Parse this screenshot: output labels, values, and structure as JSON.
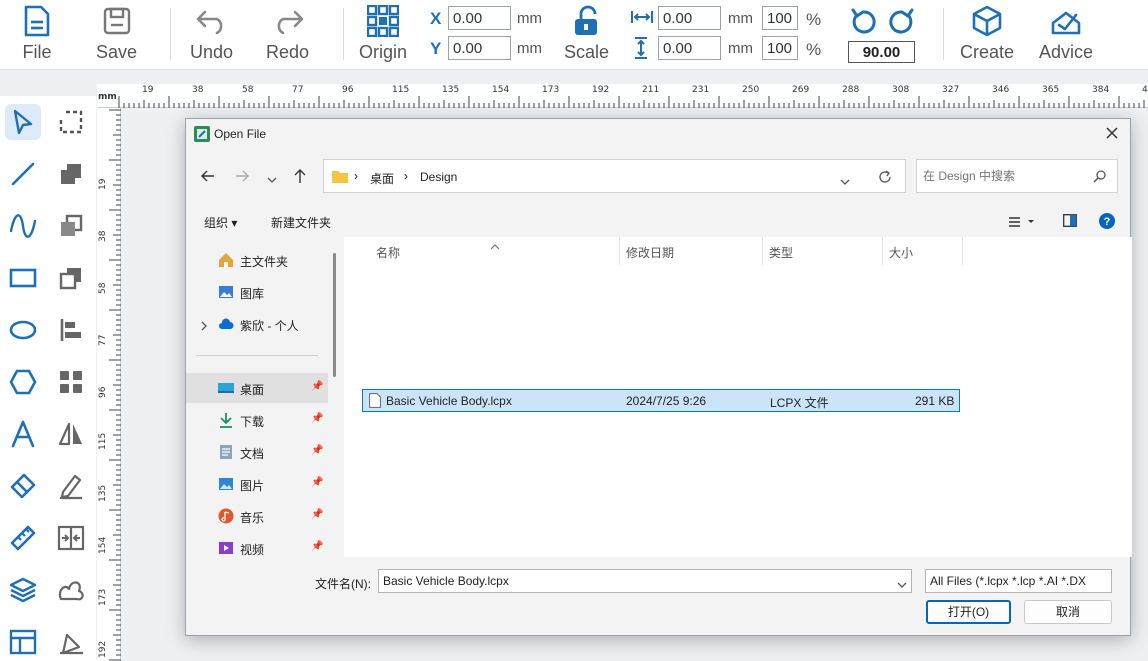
{
  "toolbar": {
    "file": "File",
    "save": "Save",
    "undo": "Undo",
    "redo": "Redo",
    "origin": "Origin",
    "x_label": "X",
    "y_label": "Y",
    "x_value": "0.00",
    "y_value": "0.00",
    "unit_mm": "mm",
    "scale": "Scale",
    "w_value": "0.00",
    "h_value": "0.00",
    "w_pct": "100",
    "h_pct": "100",
    "pct_sign": "%",
    "rotation": "90.00",
    "create": "Create",
    "advice": "Advice"
  },
  "ruler": {
    "unit": "mm",
    "top_labels": [
      "19",
      "38",
      "58",
      "77",
      "96",
      "115",
      "135",
      "154",
      "173",
      "192",
      "211",
      "231",
      "250",
      "269",
      "288",
      "308",
      "327",
      "346",
      "365",
      "384",
      "404"
    ],
    "left_labels": [
      "19",
      "38",
      "58",
      "77",
      "96",
      "115",
      "135",
      "154",
      "173",
      "192"
    ]
  },
  "palette": [
    "pointer-icon",
    "corner-select-icon",
    "line-icon",
    "fill-squares-icon",
    "curve-icon",
    "copy-squares-icon",
    "rectangle-icon",
    "stack-squares-icon",
    "ellipse-icon",
    "align-left-icon",
    "hexagon-icon",
    "grid-icon",
    "text-icon",
    "mirror-icon",
    "eraser-icon",
    "edit-icon",
    "ruler-icon",
    "split-icon",
    "layers-icon",
    "weld-icon",
    "layout-icon",
    "pen-tool-icon"
  ],
  "dialog": {
    "title": "Open File",
    "breadcrumb_1": "桌面",
    "breadcrumb_2": "Design",
    "search_placeholder": "在 Design 中搜索",
    "organize": "组织",
    "new_folder": "新建文件夹",
    "nav_items": [
      {
        "label": "主文件夹",
        "icon": "home-icon"
      },
      {
        "label": "图库",
        "icon": "gallery-icon"
      },
      {
        "label": "紫欣 - 个人",
        "icon": "cloud-icon"
      },
      {
        "label": "桌面",
        "icon": "desktop-icon"
      },
      {
        "label": "下载",
        "icon": "download-icon"
      },
      {
        "label": "文档",
        "icon": "document-icon"
      },
      {
        "label": "图片",
        "icon": "pictures-icon"
      },
      {
        "label": "音乐",
        "icon": "music-icon"
      },
      {
        "label": "视频",
        "icon": "video-icon"
      }
    ],
    "columns": [
      "名称",
      "修改日期",
      "类型",
      "大小"
    ],
    "files": [
      {
        "name": "Basic Vehicle Body.lcpx",
        "modified": "2024/7/25 9:26",
        "type": "LCPX 文件",
        "size": "291 KB"
      }
    ],
    "filename_label": "文件名(N):",
    "filename_value": "Basic Vehicle Body.lcpx",
    "filter_value": "All Files (*.lcpx *.lcp *.AI *.DX",
    "open_button": "打开(O)",
    "cancel_button": "取消"
  },
  "colors": {
    "accent": "#1f6fb5",
    "selection": "#cce4f7",
    "selection_border": "#0078d4"
  }
}
